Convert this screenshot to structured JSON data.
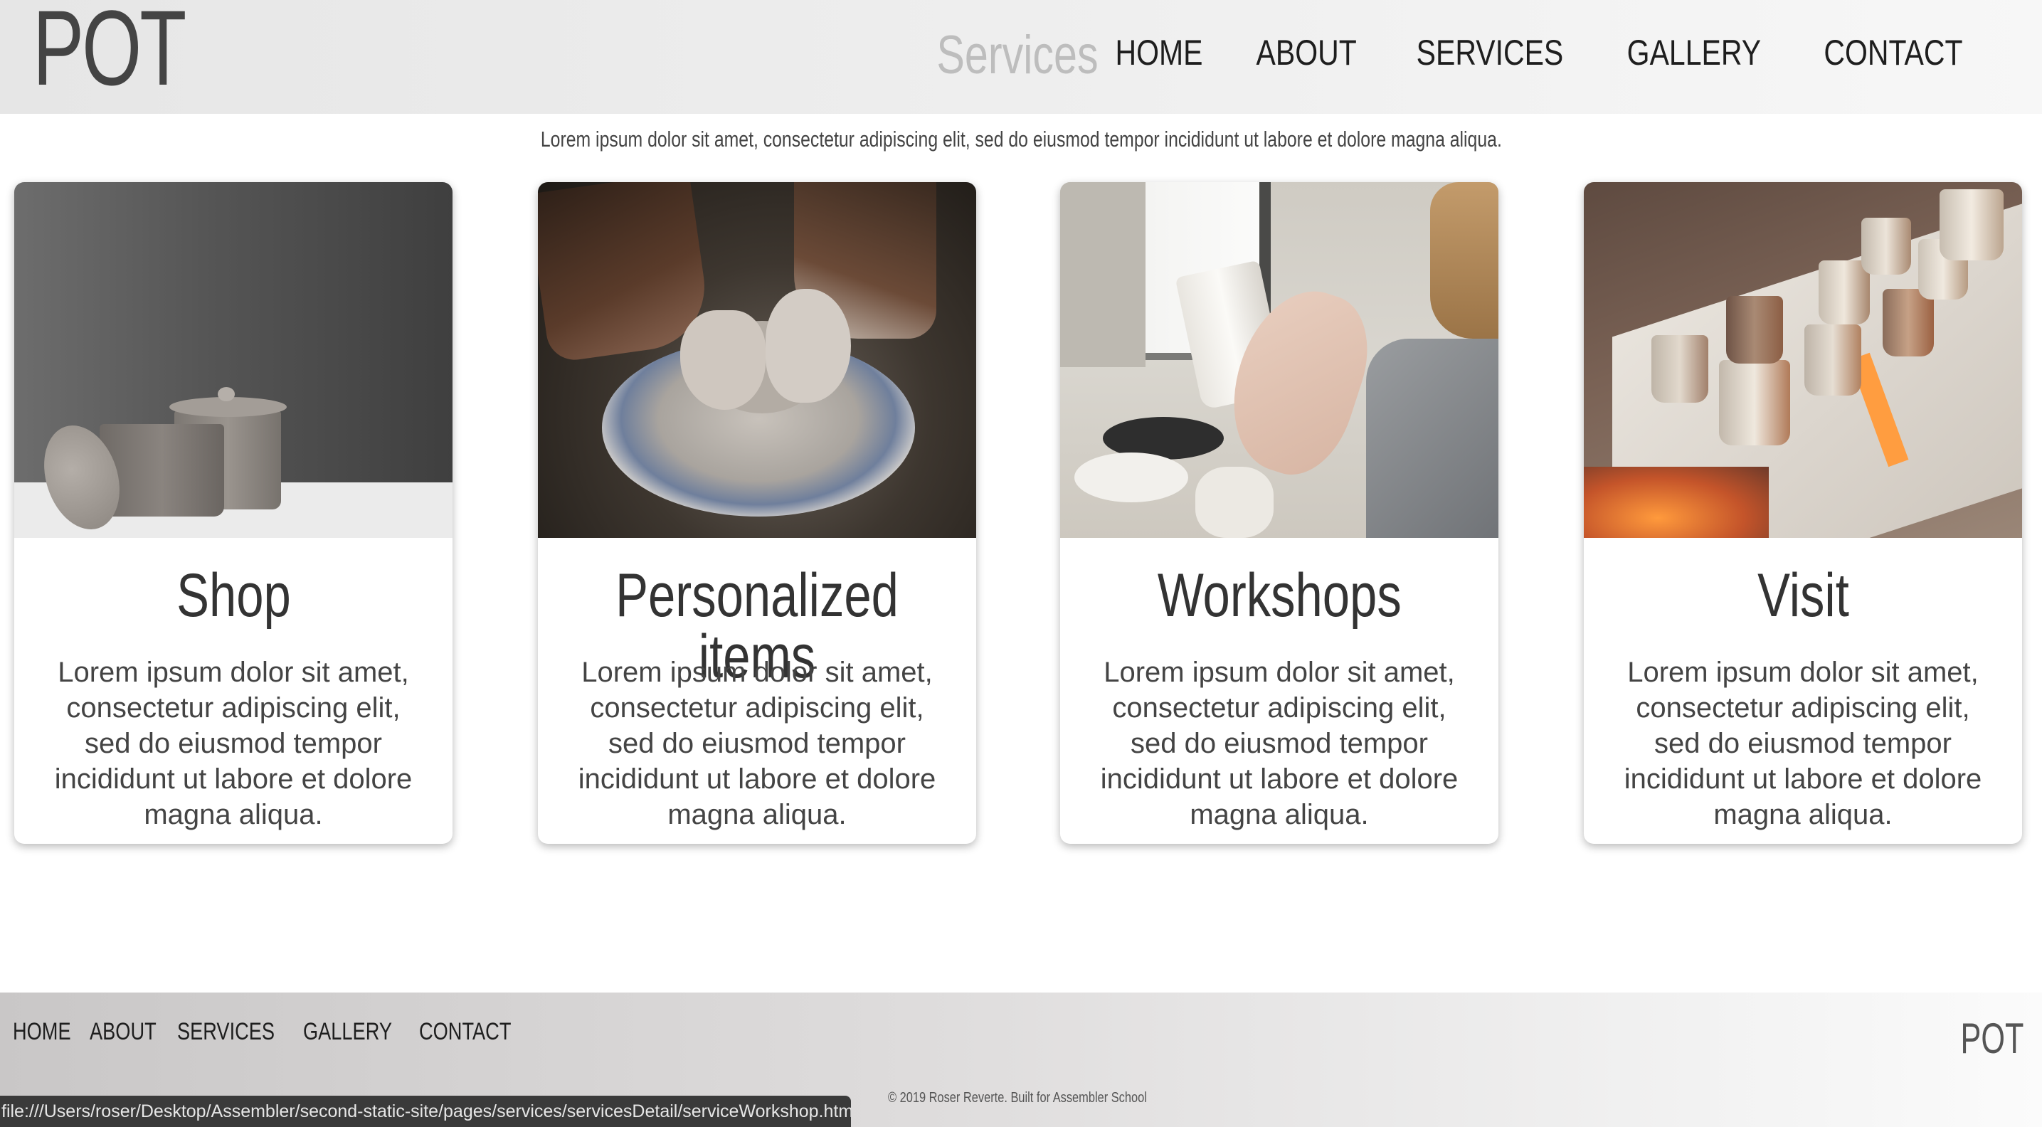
{
  "header": {
    "logo": "POT",
    "page_heading": "Services",
    "nav": [
      "HOME",
      "ABOUT",
      "SERVICES",
      "GALLERY",
      "CONTACT"
    ]
  },
  "intro": "Lorem ipsum dolor sit amet, consectetur adipiscing elit, sed do eiusmod tempor incididunt ut labore et dolore magna aliqua.",
  "cards": [
    {
      "title": "Shop",
      "text": "Lorem ipsum dolor sit amet, consectetur adipiscing elit, sed do eiusmod tempor incididunt ut labore et dolore magna aliqua."
    },
    {
      "title": "Personalized items",
      "text": "Lorem ipsum dolor sit amet, consectetur adipiscing elit, sed do eiusmod tempor incididunt ut labore et dolore magna aliqua."
    },
    {
      "title": "Workshops",
      "text": "Lorem ipsum dolor sit amet, consectetur adipiscing elit, sed do eiusmod tempor incididunt ut labore et dolore magna aliqua."
    },
    {
      "title": "Visit",
      "text": "Lorem ipsum dolor sit amet, consectetur adipiscing elit, sed do eiusmod tempor incididunt ut labore et dolore magna aliqua."
    }
  ],
  "footer": {
    "nav": [
      "HOME",
      "ABOUT",
      "SERVICES",
      "GALLERY",
      "CONTACT"
    ],
    "logo": "POT",
    "copyright": "© 2019 Roser Reverte. Built for Assembler School"
  },
  "status_bar": {
    "url": "file:///Users/roser/Desktop/Assembler/second-static-site/pages/services/servicesDetail/serviceWorkshop.html"
  }
}
